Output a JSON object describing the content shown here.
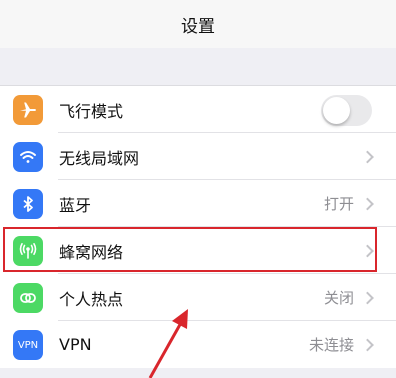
{
  "header": {
    "title": "设置"
  },
  "settings": [
    {
      "label": "飞行模式",
      "control": "toggle",
      "toggle_on": false,
      "icon": "airplane-icon",
      "icon_color": "#f29a38"
    },
    {
      "label": "无线局域网",
      "value": "",
      "control": "chevron",
      "icon": "wifi-icon",
      "icon_color": "#3478f6"
    },
    {
      "label": "蓝牙",
      "value": "打开",
      "control": "chevron",
      "icon": "bluetooth-icon",
      "icon_color": "#3478f6"
    },
    {
      "label": "蜂窝网络",
      "value": "",
      "control": "chevron",
      "icon": "cellular-icon",
      "icon_color": "#4cd964"
    },
    {
      "label": "个人热点",
      "value": "关闭",
      "control": "chevron",
      "icon": "hotspot-icon",
      "icon_color": "#4cd964"
    },
    {
      "label": "VPN",
      "value": "未连接",
      "control": "chevron",
      "icon": "vpn-icon",
      "icon_color": "#3478f6",
      "icon_text": "VPN"
    }
  ],
  "annotation": {
    "highlight_color": "#d9262c"
  }
}
